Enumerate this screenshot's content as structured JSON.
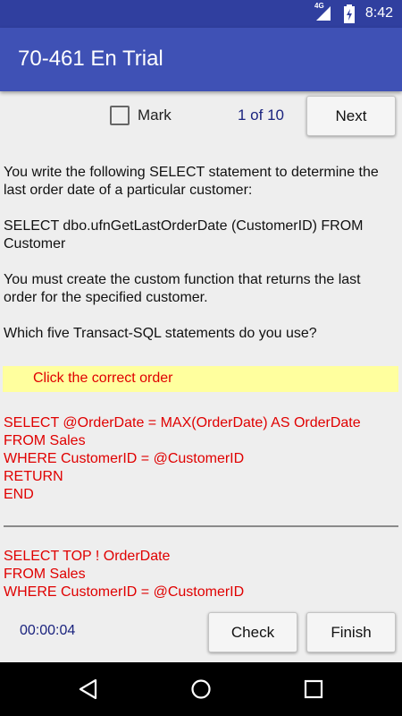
{
  "status_bar": {
    "network": "4G",
    "time": "8:42"
  },
  "app_bar": {
    "title": "70-461 En Trial"
  },
  "toolbar": {
    "mark_label": "Mark",
    "counter": "1 of 10",
    "next_label": "Next"
  },
  "question": {
    "paragraphs": [
      "You write the following SELECT statement to determine the last order date of a particular customer:",
      "SELECT dbo.ufnGetLastOrderDate (CustomerID) FROM Customer",
      "You must create the custom function that returns the last order for the specified customer.",
      "Which five Transact-SQL statements do you use?"
    ]
  },
  "instruction": "Click the correct order",
  "answer_blocks": [
    [
      "SELECT @OrderDate = MAX(OrderDate) AS OrderDate",
      "FROM Sales",
      "WHERE CustomerID = @CustomerID",
      "RETURN",
      "END"
    ],
    [
      "SELECT TOP ! OrderDate",
      "FROM Sales",
      "WHERE CustomerID = @CustomerID"
    ]
  ],
  "footer": {
    "timer": "00:00:04",
    "check_label": "Check",
    "finish_label": "Finish"
  },
  "colors": {
    "primary": "#3f51b5",
    "primary_dark": "#303f9f",
    "answer_text": "#e00000",
    "highlight": "#ffff9e"
  },
  "icons": [
    "signal-icon",
    "battery-icon",
    "back-icon",
    "home-icon",
    "recents-icon"
  ]
}
